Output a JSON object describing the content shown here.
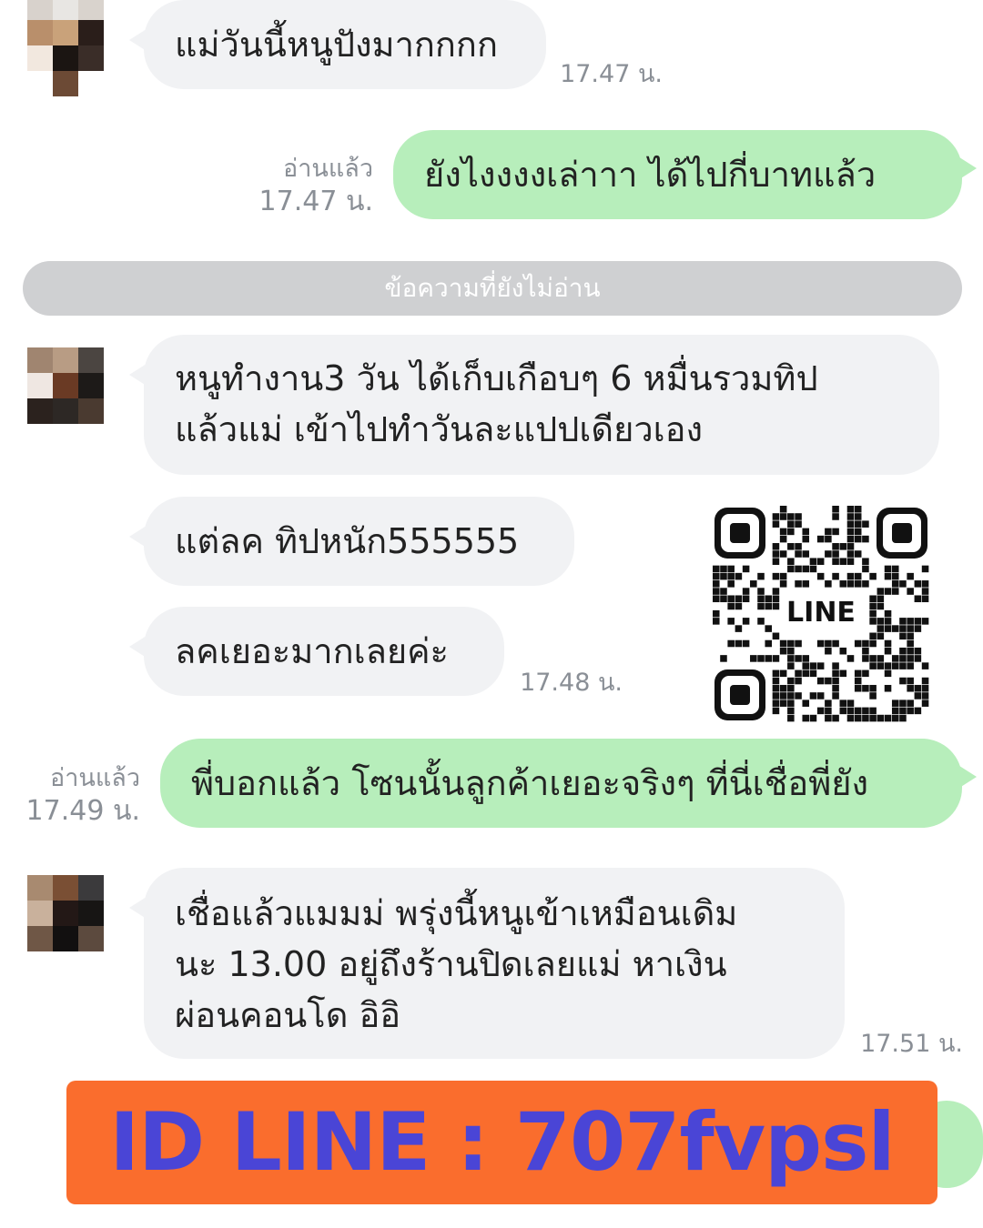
{
  "messages": [
    {
      "from": "them",
      "text": "แม่วันนี้หนูปังมากกกก",
      "time": "17.47 น."
    },
    {
      "from": "me",
      "text": "ยังไงงงงเล่าาา  ได้ไปกี่บาทแล้ว",
      "read": "อ่านแล้ว",
      "time": "17.47 น."
    },
    {
      "from": "them",
      "lines": [
        "หนูทำงาน3 วัน ได้เก็บเกือบๆ 6 หมื่นรวมทิป",
        "แล้วแม่ เข้าไปทำวันละแปปเดียวเอง"
      ]
    },
    {
      "from": "them",
      "text": "แต่ลค ทิปหนัก555555"
    },
    {
      "from": "them",
      "text": "ลคเยอะมากเลยค่ะ",
      "time": "17.48 น."
    },
    {
      "from": "me",
      "text": "พี่บอกแล้ว โซนนั้นลูกค้าเยอะจริงๆ ที่นี่เชื่อพี่ยัง",
      "read": "อ่านแล้ว",
      "time": "17.49 น."
    },
    {
      "from": "them",
      "lines": [
        "เชื่อแล้วแมมม่ พรุ่งนี้หนูเข้าเหมือนเดิม",
        "นะ 13.00 อยู่ถึงร้านปิดเลยแม่ หาเงิน",
        "ผ่อนคอนโด อิอิ"
      ],
      "time": "17.51 น."
    }
  ],
  "unread_divider": "ข้อความที่ยังไม่อ่าน",
  "qr": {
    "center_label": "LINE"
  },
  "banner": {
    "text": "ID LINE : 707fvpsl",
    "bg_color": "#fa6d2d",
    "text_color": "#4a45d6"
  },
  "colors": {
    "incoming_bubble": "#f1f2f4",
    "outgoing_bubble": "#b7eebb",
    "meta_text": "#8a8f96"
  }
}
